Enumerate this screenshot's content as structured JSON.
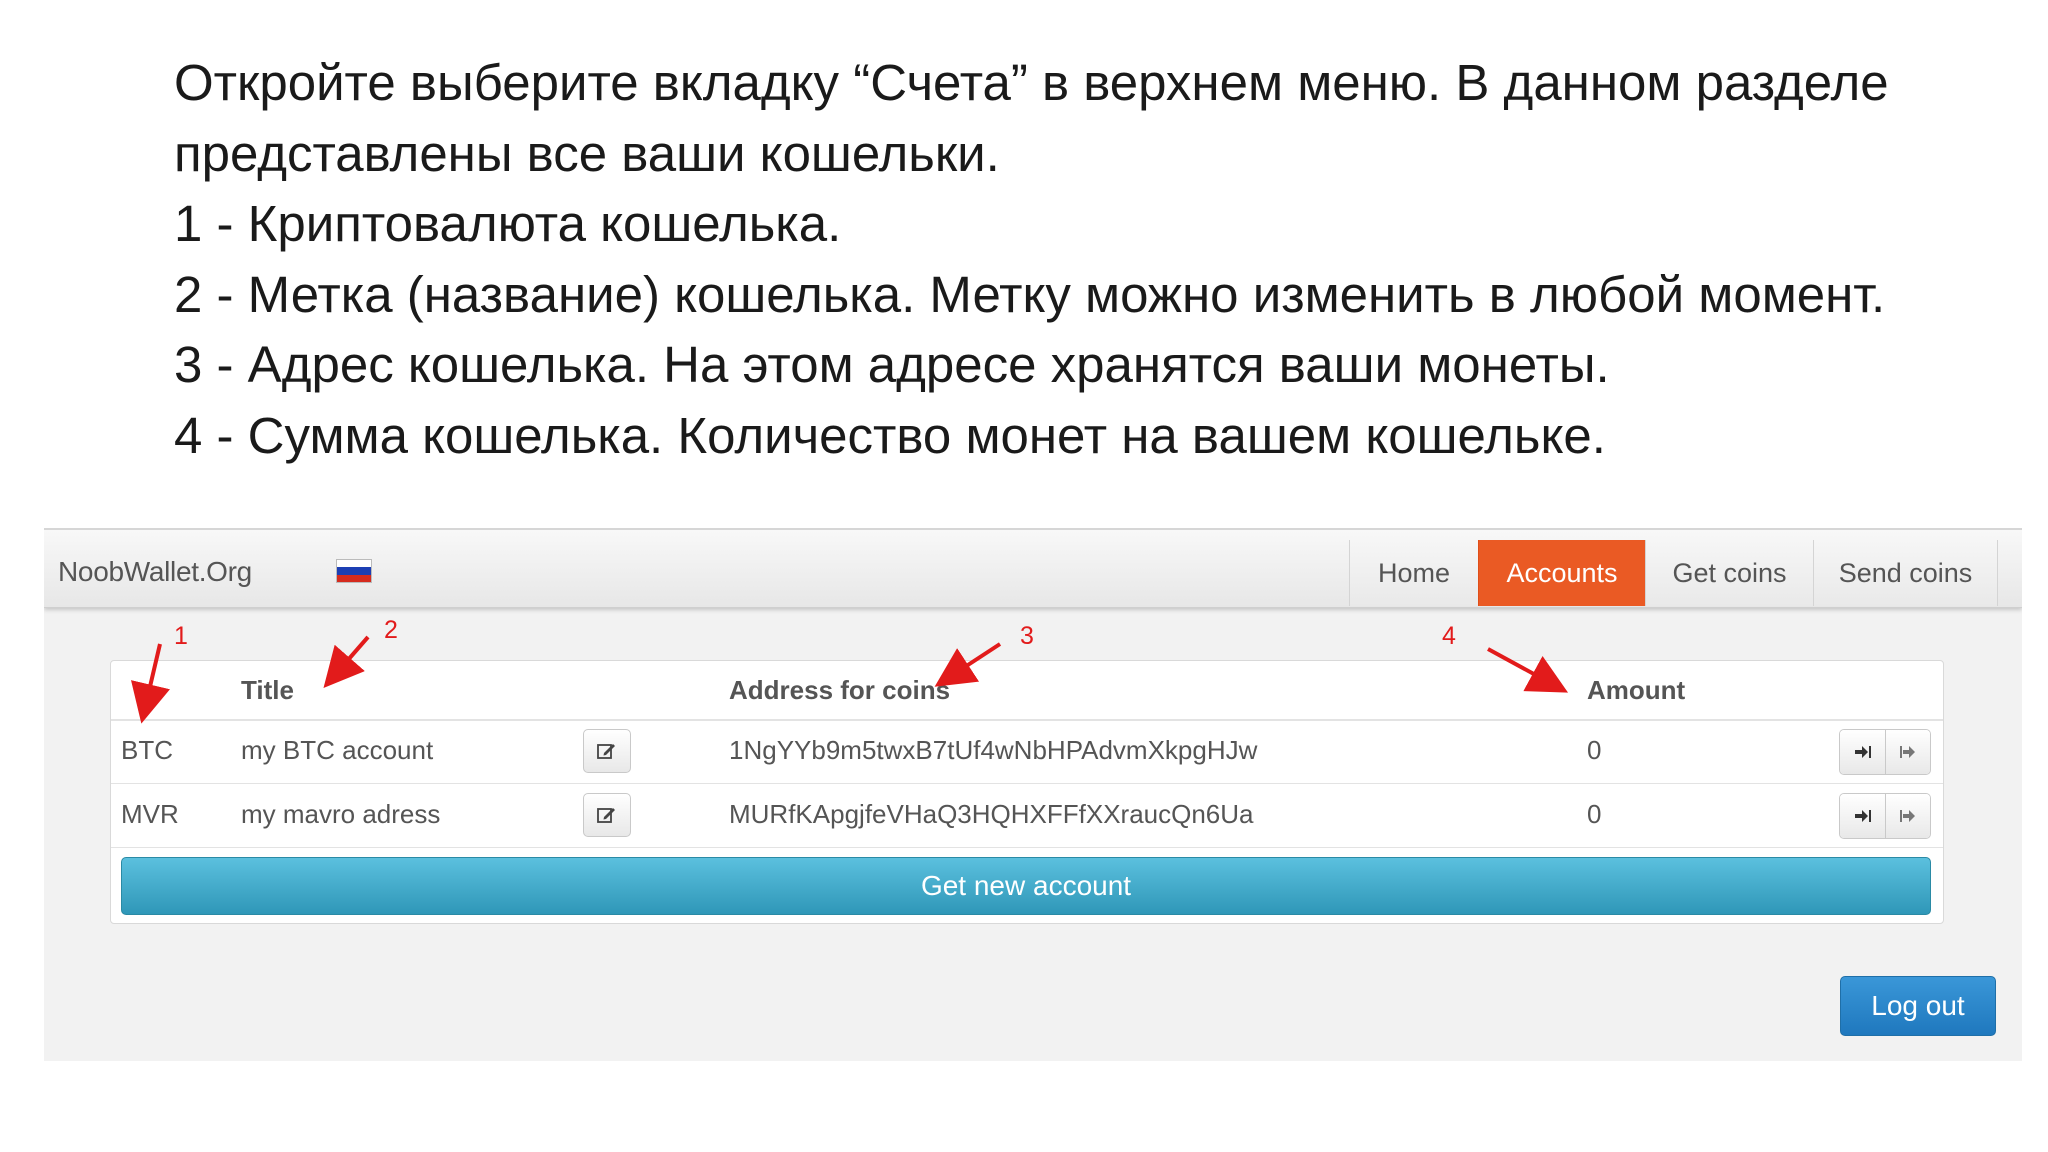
{
  "instructions": {
    "lines": [
      "Откройте выберите вкладку “Счета” в верхнем меню. В данном разделе",
      "представлены все ваши кошельки.",
      "1 - Криптовалюта кошелька.",
      "2 - Метка (название) кошелька. Метку можно изменить в любой момент.",
      "3 - Адрес кошелька. На этом адресе хранятся ваши монеты.",
      "4 - Сумма кошелька. Количество монет на вашем кошельке."
    ]
  },
  "navbar": {
    "brand": "NoobWallet.Org",
    "flag_icon": "russia-flag-icon",
    "menu": {
      "home": "Home",
      "accounts": "Accounts",
      "get_coins": "Get coins",
      "send_coins": "Send coins"
    },
    "active_color": "#ea5a24"
  },
  "table": {
    "headers": {
      "currency": "",
      "title": "Title",
      "address": "Address for coins",
      "amount": "Amount"
    },
    "rows": [
      {
        "currency": "BTC",
        "title": "my BTC account",
        "address": "1NgYYb9m5twxB7tUf4wNbHPAdvmXkpgHJw",
        "amount": "0"
      },
      {
        "currency": "MVR",
        "title": "my mavro adress",
        "address": "MURfKApgjfeVHaQ3HQHXFFfXXraucQn6Ua",
        "amount": "0"
      }
    ],
    "icons": {
      "edit": "edit-icon",
      "receive": "sign-in-icon",
      "send": "sign-out-icon"
    }
  },
  "buttons": {
    "get_new_account": "Get new account",
    "log_out": "Log out"
  },
  "annotations": [
    "1",
    "2",
    "3",
    "4"
  ],
  "colors": {
    "annotation": "#e21b1b",
    "info_button": "#3aa8c9",
    "primary_button": "#2b85c9"
  }
}
